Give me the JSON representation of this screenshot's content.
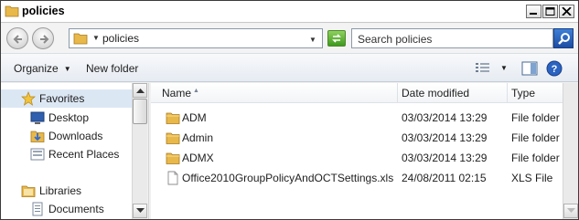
{
  "window": {
    "title": "policies",
    "controls": [
      "minimize",
      "maximize",
      "close"
    ]
  },
  "address_bar": {
    "path": "policies",
    "search_placeholder": "Search policies"
  },
  "toolbar": {
    "organize_label": "Organize",
    "new_folder_label": "New folder"
  },
  "nav_pane": {
    "items": [
      {
        "label": "Favorites",
        "icon": "star-icon",
        "selected": true
      },
      {
        "label": "Desktop",
        "icon": "desktop-icon"
      },
      {
        "label": "Downloads",
        "icon": "downloads-icon"
      },
      {
        "label": "Recent Places",
        "icon": "recent-places-icon"
      },
      {
        "label": "Libraries",
        "icon": "libraries-icon"
      },
      {
        "label": "Documents",
        "icon": "documents-icon"
      }
    ]
  },
  "file_list": {
    "columns": [
      "Name",
      "Date modified",
      "Type"
    ],
    "rows": [
      {
        "name": "ADM",
        "date": "03/03/2014 13:29",
        "type": "File folder",
        "icon": "folder-icon"
      },
      {
        "name": "Admin",
        "date": "03/03/2014 13:29",
        "type": "File folder",
        "icon": "folder-icon"
      },
      {
        "name": "ADMX",
        "date": "03/03/2014 13:29",
        "type": "File folder",
        "icon": "folder-icon"
      },
      {
        "name": "Office2010GroupPolicyAndOCTSettings.xls",
        "date": "24/08/2011 02:15",
        "type": "XLS File",
        "icon": "document-icon"
      }
    ]
  },
  "colors": {
    "folder": "#e8b84a",
    "selection": "#dce7f4",
    "accent": "#1c4da3"
  }
}
